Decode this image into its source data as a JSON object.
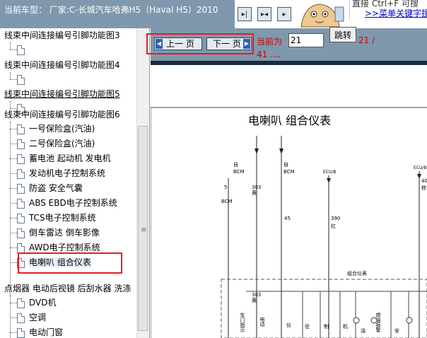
{
  "header": {
    "vehicle_line": "当前车型： 厂家:C-长城汽车哈弗H5（Haval H5）2010",
    "nav_buttons": [
      {
        "icon": "step-forward-icon",
        "glyph": "▸|"
      },
      {
        "icon": "expand-icon",
        "glyph": "▸◂"
      },
      {
        "icon": "collapse-icon",
        "glyph": "▸"
      }
    ],
    "tip_line1": "直接 Ctrl+F 可搜",
    "tip_line2": ">>菜单关键字搜"
  },
  "sidebar": {
    "items": [
      {
        "label": "线束中间连接编号引脚功能图3",
        "type": "folder"
      },
      {
        "label": "",
        "type": "doc"
      },
      {
        "label": "线束中间连接编号引脚功能图4",
        "type": "folder"
      },
      {
        "label": "",
        "type": "doc"
      },
      {
        "label": "线束中间连接编号引脚功能图5",
        "type": "folder"
      },
      {
        "label": "",
        "type": "doc"
      },
      {
        "label": "线束中间连接编号引脚功能图6",
        "type": "folder"
      },
      {
        "label": "一号保险盒(汽油)",
        "type": "doc"
      },
      {
        "label": "二号保险盒(汽油)",
        "type": "doc"
      },
      {
        "label": "蓄电池 起动机 发电机",
        "type": "doc"
      },
      {
        "label": "发动机电子控制系统",
        "type": "doc"
      },
      {
        "label": "防盗 安全气囊",
        "type": "doc"
      },
      {
        "label": "ABS EBD电子控制系统",
        "type": "doc"
      },
      {
        "label": "TCS电子控制系统",
        "type": "doc"
      },
      {
        "label": "倒车雷达 倒车影像",
        "type": "doc"
      },
      {
        "label": "AWD电子控制系统",
        "type": "doc"
      },
      {
        "label": "电喇叭 组合仪表",
        "type": "doc",
        "selected": true
      },
      {
        "label": "点烟器 电动后视镜 后刮水器 洗涤",
        "type": "folder"
      },
      {
        "label": "DVD机",
        "type": "doc"
      },
      {
        "label": "空调",
        "type": "doc"
      },
      {
        "label": "电动门窗",
        "type": "doc"
      }
    ]
  },
  "toolbar": {
    "prev_label": "上一 页",
    "next_label": "下一 页",
    "current_label": "当前为",
    "page_value": "21",
    "jump_label": "跳转",
    "total_a": "21 /",
    "total_b": "41 ...."
  },
  "diagram": {
    "title": "电喇叭  组合仪表",
    "labels": {
      "bcm1_top": "自",
      "bcm1_name": "BCM",
      "bcm2_top": "自",
      "bcm2_name": "BCM",
      "left_num": "5",
      "left_bcm": "BCM",
      "w303a": "303",
      "w303a_c": "黄",
      "w45": "45",
      "ecu": "ECU/B",
      "w390": "390",
      "w390_c": "红",
      "cluster": "组合仪表",
      "ecu_right": "ECU/B",
      "w40": "40",
      "w40_c": "棕",
      "w303b": "303",
      "w303b_c": "黄",
      "v_door": "车门指示",
      "v_power": "电动",
      "v_meter": "仪",
      "v_live": "驻",
      "v_brake": "制",
      "v_fuel": "机",
      "v_trans": "油",
      "v_alarm": "燃油报警",
      "v_lamp": "安"
    }
  },
  "colors": {
    "panel": "#7f98ad",
    "accent_red": "#d00000",
    "link": "#0000cc"
  }
}
